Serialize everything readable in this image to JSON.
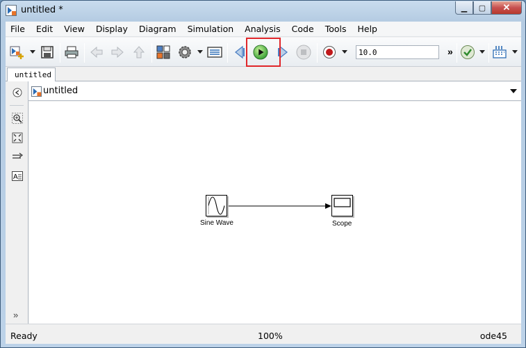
{
  "window": {
    "title": "untitled *"
  },
  "menubar": {
    "items": [
      "File",
      "Edit",
      "View",
      "Display",
      "Diagram",
      "Simulation",
      "Analysis",
      "Code",
      "Tools",
      "Help"
    ]
  },
  "toolbar": {
    "stop_time": "10.0",
    "more": "»",
    "icons": [
      "new-model-icon",
      "save-icon",
      "print-icon",
      "back-icon",
      "forward-icon",
      "up-icon",
      "library-browser-icon",
      "model-config-icon",
      "model-explorer-icon",
      "step-back-icon",
      "run-icon",
      "step-forward-icon",
      "stop-icon",
      "record-icon",
      "check-icon",
      "build-icon"
    ]
  },
  "tabs": [
    {
      "label": "untitled"
    }
  ],
  "address": {
    "path": "untitled"
  },
  "palette": {
    "more": "»"
  },
  "diagram": {
    "blocks": [
      {
        "label": "Sine Wave"
      },
      {
        "label": "Scope"
      }
    ]
  },
  "status": {
    "left": "Ready",
    "zoom": "100%",
    "solver": "ode45"
  },
  "colors": {
    "highlight": "#e0262a",
    "run": "#2e9a2e",
    "record": "#c0181a"
  }
}
